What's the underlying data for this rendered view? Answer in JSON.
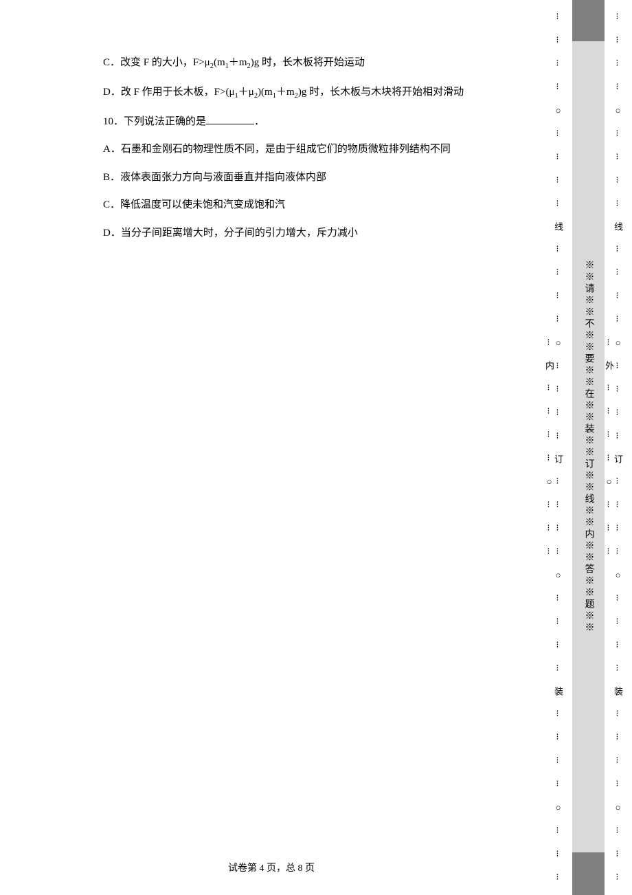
{
  "content": {
    "lineC_prefix": "C．改变 F 的大小，F>μ",
    "lineC_sub1": "2",
    "lineC_mid1": "(m",
    "lineC_sub2": "1",
    "lineC_mid2": "＋m",
    "lineC_sub3": "2",
    "lineC_suffix": ")g 时，长木板将开始运动",
    "lineD_prefix": "D．改 F 作用于长木板，F>(μ",
    "lineD_sub1": "1",
    "lineD_mid1": "＋μ",
    "lineD_sub2": "2",
    "lineD_mid2": ")(m",
    "lineD_sub3": "1",
    "lineD_mid3": "＋m",
    "lineD_sub4": "2",
    "lineD_suffix": ")g 时，长木板与木块将开始相对滑动",
    "q10_prefix": "10．下列说法正确的是",
    "q10_suffix": "．",
    "optA": "A．石墨和金刚石的物理性质不同，是由于组成它们的物质微粒排列结构不同",
    "optB": "B．液体表面张力方向与液面垂直并指向液体内部",
    "optC": "C．降低温度可以使未饱和汽变成饱和汽",
    "optD": "D．当分子间距离增大时，分子间的引力增大，斥力减小"
  },
  "footer": {
    "prefix": "试卷第 ",
    "page": "4",
    "mid": " 页，总 ",
    "total": "8",
    "suffix": " 页"
  },
  "sidebar": {
    "middle_text": "※※请※※不※※要※※在※※装※※订※※线※※内※※答※※题※※",
    "pattern_inner": "⁝ ⁝ ⁝ ⁝ ○ ⁝ ⁝ ⁝ ⁝ 线 ⁝ ⁝ ⁝ ⁝ ○ ⁝ ⁝ ⁝ ⁝ 订 ⁝ ⁝ ⁝ ⁝ ○ ⁝ ⁝ ⁝ ⁝ 装 ⁝ ⁝ ⁝ ⁝ ○ ⁝ ⁝ ⁝ ⁝ 内 ⁝ ⁝ ⁝ ⁝ ○ ⁝ ⁝ ⁝",
    "pattern_outer": "⁝ ⁝ ⁝ ⁝ ○ ⁝ ⁝ ⁝ ⁝ 线 ⁝ ⁝ ⁝ ⁝ ○ ⁝ ⁝ ⁝ ⁝ 订 ⁝ ⁝ ⁝ ⁝ ○ ⁝ ⁝ ⁝ ⁝ 装 ⁝ ⁝ ⁝ ⁝ ○ ⁝ ⁝ ⁝ ⁝ 外 ⁝ ⁝ ⁝ ⁝ ○ ⁝ ⁝ ⁝"
  }
}
